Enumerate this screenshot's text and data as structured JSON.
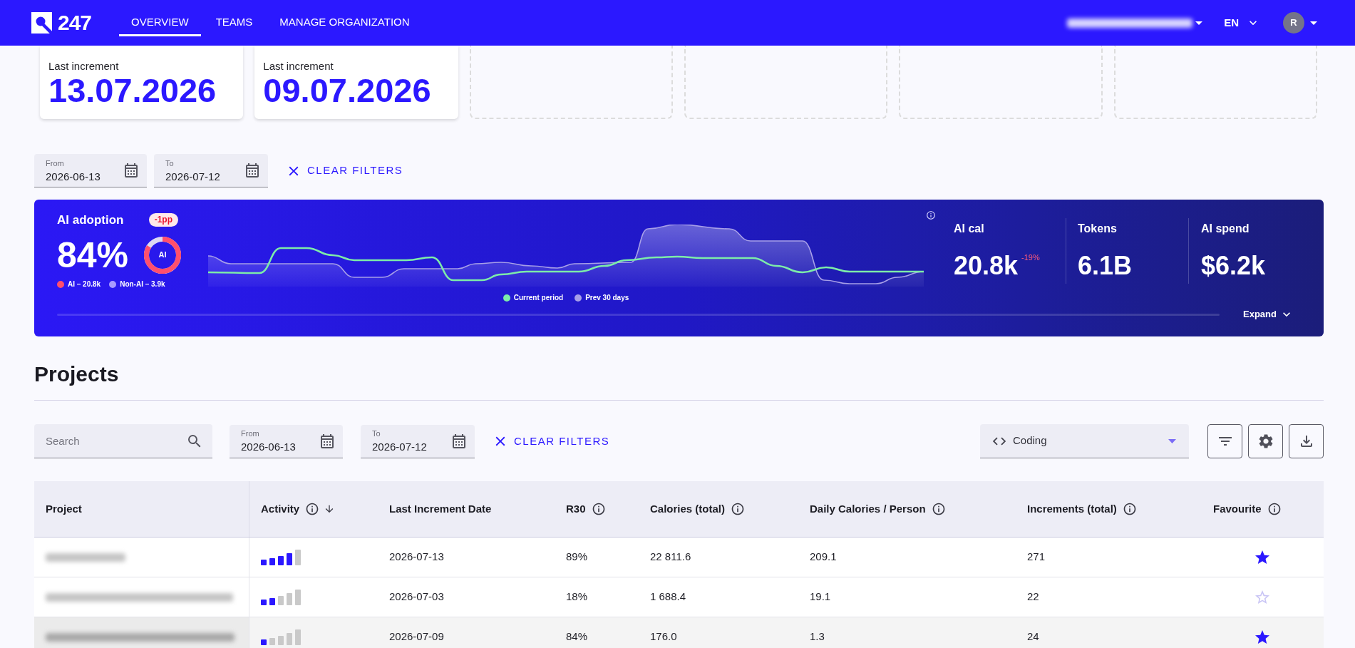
{
  "header": {
    "logo_text": "247",
    "nav": [
      {
        "label": "OVERVIEW",
        "selected": true
      },
      {
        "label": "TEAMS",
        "selected": false
      },
      {
        "label": "MANAGE ORGANIZATION",
        "selected": false
      }
    ],
    "language": "EN",
    "avatar_initial": "R"
  },
  "summary_cards": [
    {
      "kind": "stat",
      "label": "Last increment",
      "value": "13.07.2026"
    },
    {
      "kind": "stat",
      "label": "Last increment",
      "value": "09.07.2026"
    },
    {
      "kind": "empty"
    },
    {
      "kind": "empty"
    },
    {
      "kind": "empty"
    },
    {
      "kind": "empty"
    }
  ],
  "date_filters": {
    "from": {
      "label": "From",
      "value": "2026-06-13"
    },
    "to": {
      "label": "To",
      "value": "2026-07-12"
    },
    "clear_button": "CLEAR FILTERS"
  },
  "ai_banner": {
    "title": "AI adoption",
    "change_badge": "-1pp",
    "adoption": "84%",
    "donut": {
      "label": "AI",
      "level": 0.84
    },
    "split_legend": [
      {
        "label": "AI – 20.8k",
        "color": "#ff4f6d"
      },
      {
        "label": "Non-AI – 3.9k",
        "color": "#a99bff"
      }
    ],
    "chart_legend": [
      {
        "label": "Current period",
        "color": "#7deba9"
      },
      {
        "label": "Prev 30 days",
        "color": "#a79fe8"
      }
    ],
    "stats": [
      {
        "label": "AI cal",
        "value": "20.8k",
        "change": "-19%"
      },
      {
        "label": "Tokens",
        "value": "6.1B"
      },
      {
        "label": "AI spend",
        "value": "$6.2k"
      }
    ],
    "expand_button": "Expand"
  },
  "projects": {
    "title": "Projects",
    "search": {
      "placeholder": "Search"
    },
    "from": {
      "label": "From",
      "value": "2026-06-13"
    },
    "to": {
      "label": "To",
      "value": "2026-07-12"
    },
    "clear_button": "CLEAR FILTERS",
    "category_select": {
      "value": "Coding"
    },
    "table": {
      "columns": [
        {
          "label": "Project",
          "info": false,
          "sorted": false
        },
        {
          "label": "Activity",
          "info": true,
          "sorted": true
        },
        {
          "label": "Last Increment Date",
          "info": false,
          "sorted": false
        },
        {
          "label": "R30",
          "info": true,
          "sorted": false
        },
        {
          "label": "Calories (total)",
          "info": true,
          "sorted": false
        },
        {
          "label": "Daily Calories / Person",
          "info": true,
          "sorted": false
        },
        {
          "label": "Increments (total)",
          "info": true,
          "sorted": false
        },
        {
          "label": "Favourite",
          "info": true,
          "sorted": false
        }
      ],
      "rows": [
        {
          "highlighted": false,
          "activity": {
            "level": 0.8
          },
          "last_increment_date": "2026-07-13",
          "r30": "89%",
          "calories_total": "22 811.6",
          "daily_calories_per_person": "209.1",
          "increments_total": "271",
          "favourite": true
        },
        {
          "highlighted": false,
          "activity": {
            "level": 0.4
          },
          "last_increment_date": "2026-07-03",
          "r30": "18%",
          "calories_total": "1 688.4",
          "daily_calories_per_person": "19.1",
          "increments_total": "22",
          "favourite": false
        },
        {
          "highlighted": true,
          "activity": {
            "level": 0.2
          },
          "last_increment_date": "2026-07-09",
          "r30": "84%",
          "calories_total": "176.0",
          "daily_calories_per_person": "1.3",
          "increments_total": "24",
          "favourite": true
        }
      ]
    }
  }
}
